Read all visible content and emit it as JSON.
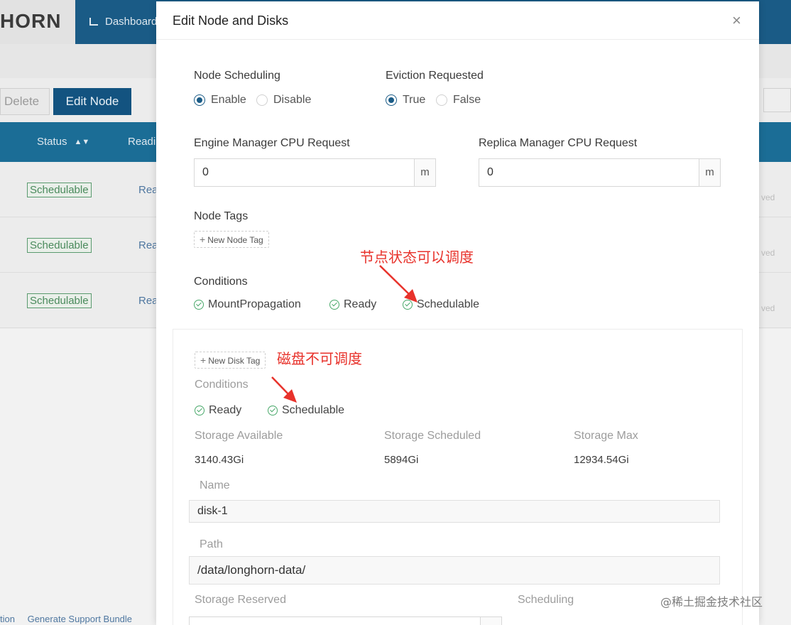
{
  "app": {
    "logo_text": "HORN",
    "nav_item": "Dashboard"
  },
  "toolbar": {
    "delete_label": "Delete",
    "edit_node_label": "Edit Node"
  },
  "table": {
    "headers": [
      "Status",
      "Readi"
    ],
    "rows": [
      {
        "status": "Schedulable",
        "ready": "Rea",
        "faded": "ved"
      },
      {
        "status": "Schedulable",
        "ready": "Rea",
        "faded": "ved"
      },
      {
        "status": "Schedulable",
        "ready": "Rea",
        "faded": "ved"
      }
    ]
  },
  "footer": {
    "links": [
      "tion",
      "Generate Support Bundle"
    ]
  },
  "modal": {
    "title": "Edit Node and Disks",
    "close_glyph": "×",
    "node_scheduling": {
      "label": "Node Scheduling",
      "options": [
        "Enable",
        "Disable"
      ],
      "selected": "Enable"
    },
    "eviction_requested": {
      "label": "Eviction Requested",
      "options": [
        "True",
        "False"
      ],
      "selected": "True"
    },
    "engine_cpu": {
      "label": "Engine Manager CPU Request",
      "value": "0",
      "unit": "m"
    },
    "replica_cpu": {
      "label": "Replica Manager CPU Request",
      "value": "0",
      "unit": "m"
    },
    "node_tags": {
      "label": "Node Tags",
      "new_tag_label": "New Node Tag"
    },
    "conditions": {
      "label": "Conditions",
      "items": [
        "MountPropagation",
        "Ready",
        "Schedulable"
      ]
    },
    "disk": {
      "new_tag_label": "New Disk Tag",
      "conditions_label": "Conditions",
      "conditions": [
        "Ready",
        "Schedulable"
      ],
      "storage_available_label": "Storage Available",
      "storage_available": "3140.43Gi",
      "storage_scheduled_label": "Storage Scheduled",
      "storage_scheduled": "5894Gi",
      "storage_max_label": "Storage Max",
      "storage_max": "12934.54Gi",
      "name_label": "Name",
      "name_value": "disk-1",
      "path_label": "Path",
      "path_value": "/data/longhorn-data/",
      "storage_reserved_label": "Storage Reserved",
      "scheduling_label": "Scheduling"
    }
  },
  "annotations": {
    "node_note": "节点状态可以调度",
    "disk_note": "磁盘不可调度",
    "color": "#e8322b"
  },
  "watermark": "@稀土掘金技术社区"
}
